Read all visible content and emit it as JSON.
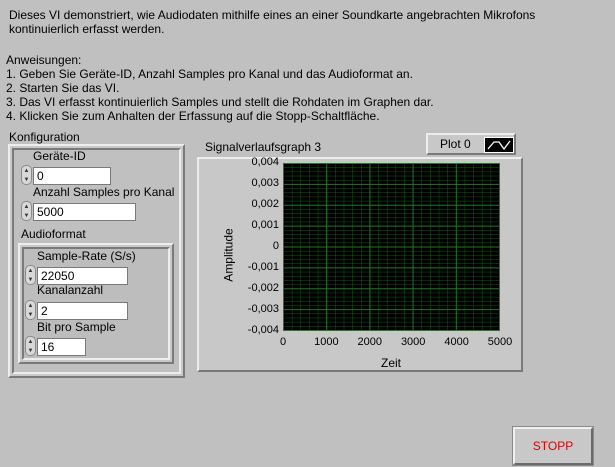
{
  "description": "Dieses VI demonstriert, wie Audiodaten mithilfe eines an einer Soundkarte angebrachten Mikrofons\nkontinuierlich erfasst werden.",
  "instructions": {
    "heading": "Anweisungen:",
    "steps": [
      "1.  Geben Sie Geräte-ID, Anzahl Samples pro Kanal und das Audioformat an.",
      "2.  Starten Sie das VI.",
      "3.  Das VI erfasst kontinuierlich Samples und stellt die Rohdaten im Graphen dar.",
      "4.  Klicken Sie zum Anhalten der Erfassung auf die Stopp-Schaltfläche."
    ]
  },
  "config": {
    "title": "Konfiguration",
    "device_id": {
      "label": "Geräte-ID",
      "value": "0"
    },
    "samples_per_channel": {
      "label": "Anzahl Samples pro Kanal",
      "value": "5000"
    },
    "audioformat": {
      "title": "Audioformat",
      "sample_rate": {
        "label": "Sample-Rate (S/s)",
        "value": "22050"
      },
      "channels": {
        "label": "Kanalanzahl",
        "value": "2"
      },
      "bits_per_sample": {
        "label": "Bit pro Sample",
        "value": "16"
      }
    }
  },
  "graph": {
    "title": "Signalverlaufsgraph 3",
    "plot_legend": "Plot 0",
    "plot_icon": "waveform-icon",
    "ylabel": "Amplitude",
    "xlabel": "Zeit",
    "yticks": [
      "0,004",
      "0,003",
      "0,002",
      "0,001",
      "0",
      "-0,001",
      "-0,002",
      "-0,003",
      "-0,004"
    ],
    "xticks": [
      "0",
      "1000",
      "2000",
      "3000",
      "4000",
      "5000"
    ],
    "grid_color": "#1f7a1f",
    "background": "#000000"
  },
  "stop_button": {
    "label": "STOPP",
    "color": "#e00000"
  }
}
